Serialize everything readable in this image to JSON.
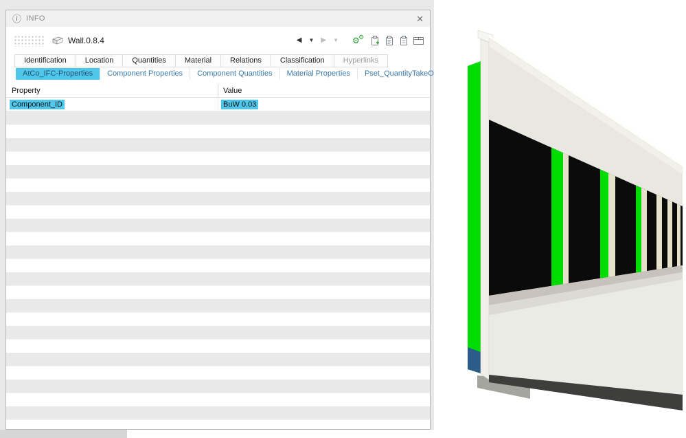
{
  "colors": {
    "highlight_cyan": "#4ec7ea",
    "tab_link_blue": "#3a78a8",
    "toolbar_green": "#2f9e38",
    "wall_green": "#00dc00",
    "wall_blue": "#2b5c8a",
    "wall_cream": "#e5e1cb"
  },
  "window": {
    "title": "INFO",
    "info_icon": "ⓘ",
    "close_icon": "✕",
    "object_name": "Wall.0.8.4"
  },
  "toolbar": {
    "nav_back": "◀",
    "nav_dropdown": "▼",
    "nav_forward": "▶",
    "nav_dropdown2": "▼"
  },
  "tabs_primary": [
    {
      "label": "Identification",
      "disabled": false
    },
    {
      "label": "Location",
      "disabled": false
    },
    {
      "label": "Quantities",
      "disabled": false
    },
    {
      "label": "Material",
      "disabled": false
    },
    {
      "label": "Relations",
      "disabled": false
    },
    {
      "label": "Classification",
      "disabled": false
    },
    {
      "label": "Hyperlinks",
      "disabled": true
    }
  ],
  "tabs_secondary": [
    {
      "label": "AtCo_IFC-Properties",
      "active": true
    },
    {
      "label": "Component Properties",
      "active": false
    },
    {
      "label": "Component Quantities",
      "active": false
    },
    {
      "label": "Material Properties",
      "active": false
    },
    {
      "label": "Pset_QuantityTakeOff",
      "active": false
    }
  ],
  "table": {
    "columns": [
      "Property",
      "Value"
    ],
    "rows": [
      {
        "property": "Component_ID",
        "value": "BuW 0.03",
        "highlighted": true
      }
    ]
  }
}
